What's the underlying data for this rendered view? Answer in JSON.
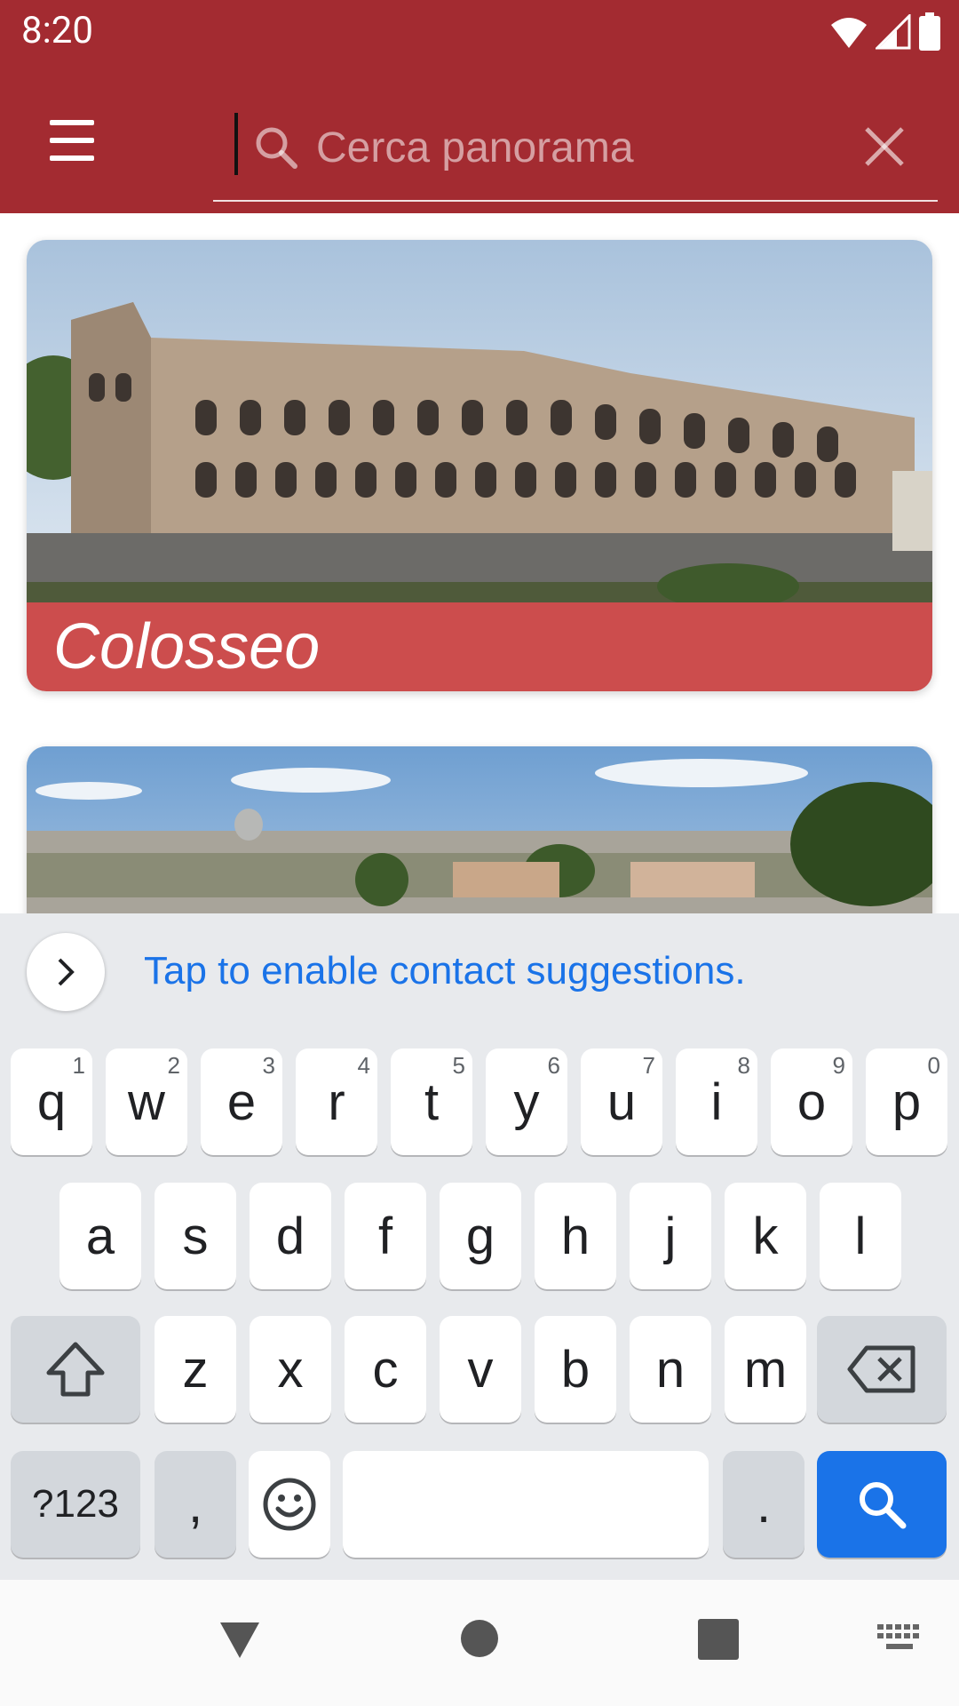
{
  "status_bar": {
    "time": "8:20"
  },
  "app_bar": {
    "search": {
      "placeholder": "Cerca panorama",
      "value": ""
    }
  },
  "cards": [
    {
      "title": "Colosseo"
    },
    {
      "title": ""
    }
  ],
  "keyboard": {
    "suggestion": "Tap to enable contact suggestions.",
    "row1": [
      {
        "k": "q",
        "h": "1"
      },
      {
        "k": "w",
        "h": "2"
      },
      {
        "k": "e",
        "h": "3"
      },
      {
        "k": "r",
        "h": "4"
      },
      {
        "k": "t",
        "h": "5"
      },
      {
        "k": "y",
        "h": "6"
      },
      {
        "k": "u",
        "h": "7"
      },
      {
        "k": "i",
        "h": "8"
      },
      {
        "k": "o",
        "h": "9"
      },
      {
        "k": "p",
        "h": "0"
      }
    ],
    "row2": [
      "a",
      "s",
      "d",
      "f",
      "g",
      "h",
      "j",
      "k",
      "l"
    ],
    "row3": [
      "z",
      "x",
      "c",
      "v",
      "b",
      "n",
      "m"
    ],
    "symbols_label": "?123",
    "comma": ",",
    "period": "."
  },
  "colors": {
    "primary": "#a32b31",
    "caption": "#cc4d4d",
    "accent": "#1a73e8"
  }
}
